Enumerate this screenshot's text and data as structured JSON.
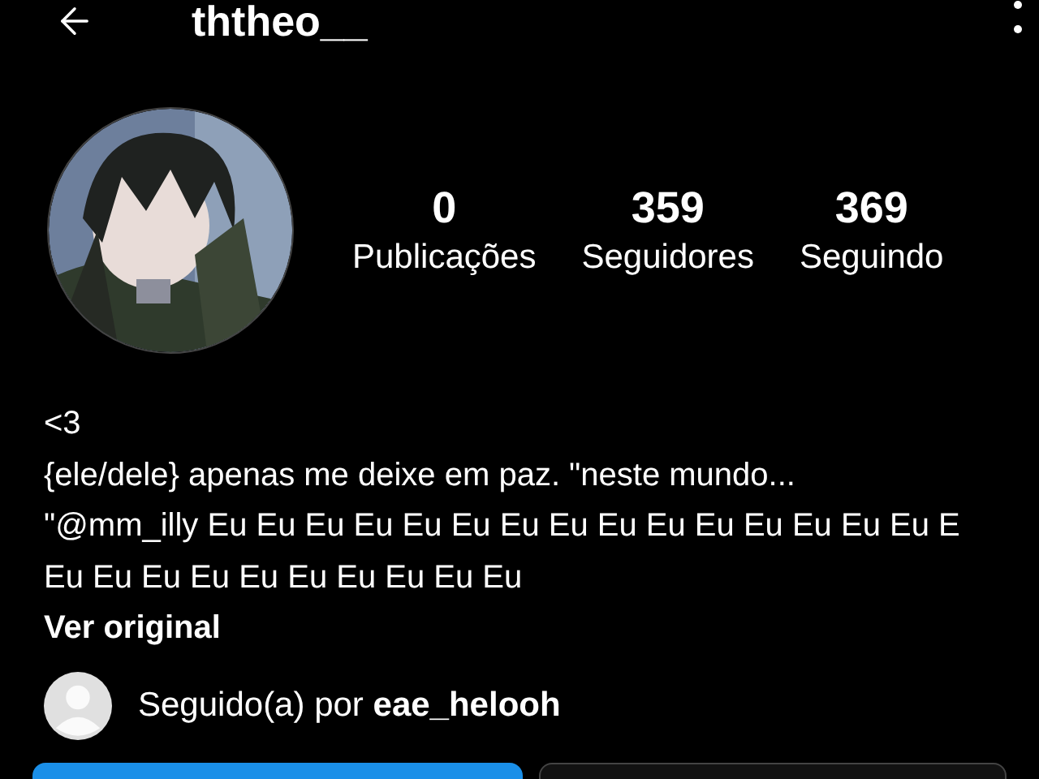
{
  "header": {
    "username": "ththeo__"
  },
  "stats": [
    {
      "value": "0",
      "label": "Publicações"
    },
    {
      "value": "359",
      "label": "Seguidores"
    },
    {
      "value": "369",
      "label": "Seguindo"
    }
  ],
  "bio": {
    "lines": [
      "<3",
      "{ele/dele} apenas me deixe em paz. \"neste mundo...",
      "\"@mm_illy Eu Eu Eu Eu Eu Eu Eu Eu Eu Eu Eu Eu Eu Eu Eu E",
      "Eu Eu Eu Eu Eu Eu Eu Eu Eu Eu"
    ],
    "see_original": "Ver original"
  },
  "followed_by": {
    "prefix": "Seguido(a) por",
    "user": "eae_helooh"
  }
}
